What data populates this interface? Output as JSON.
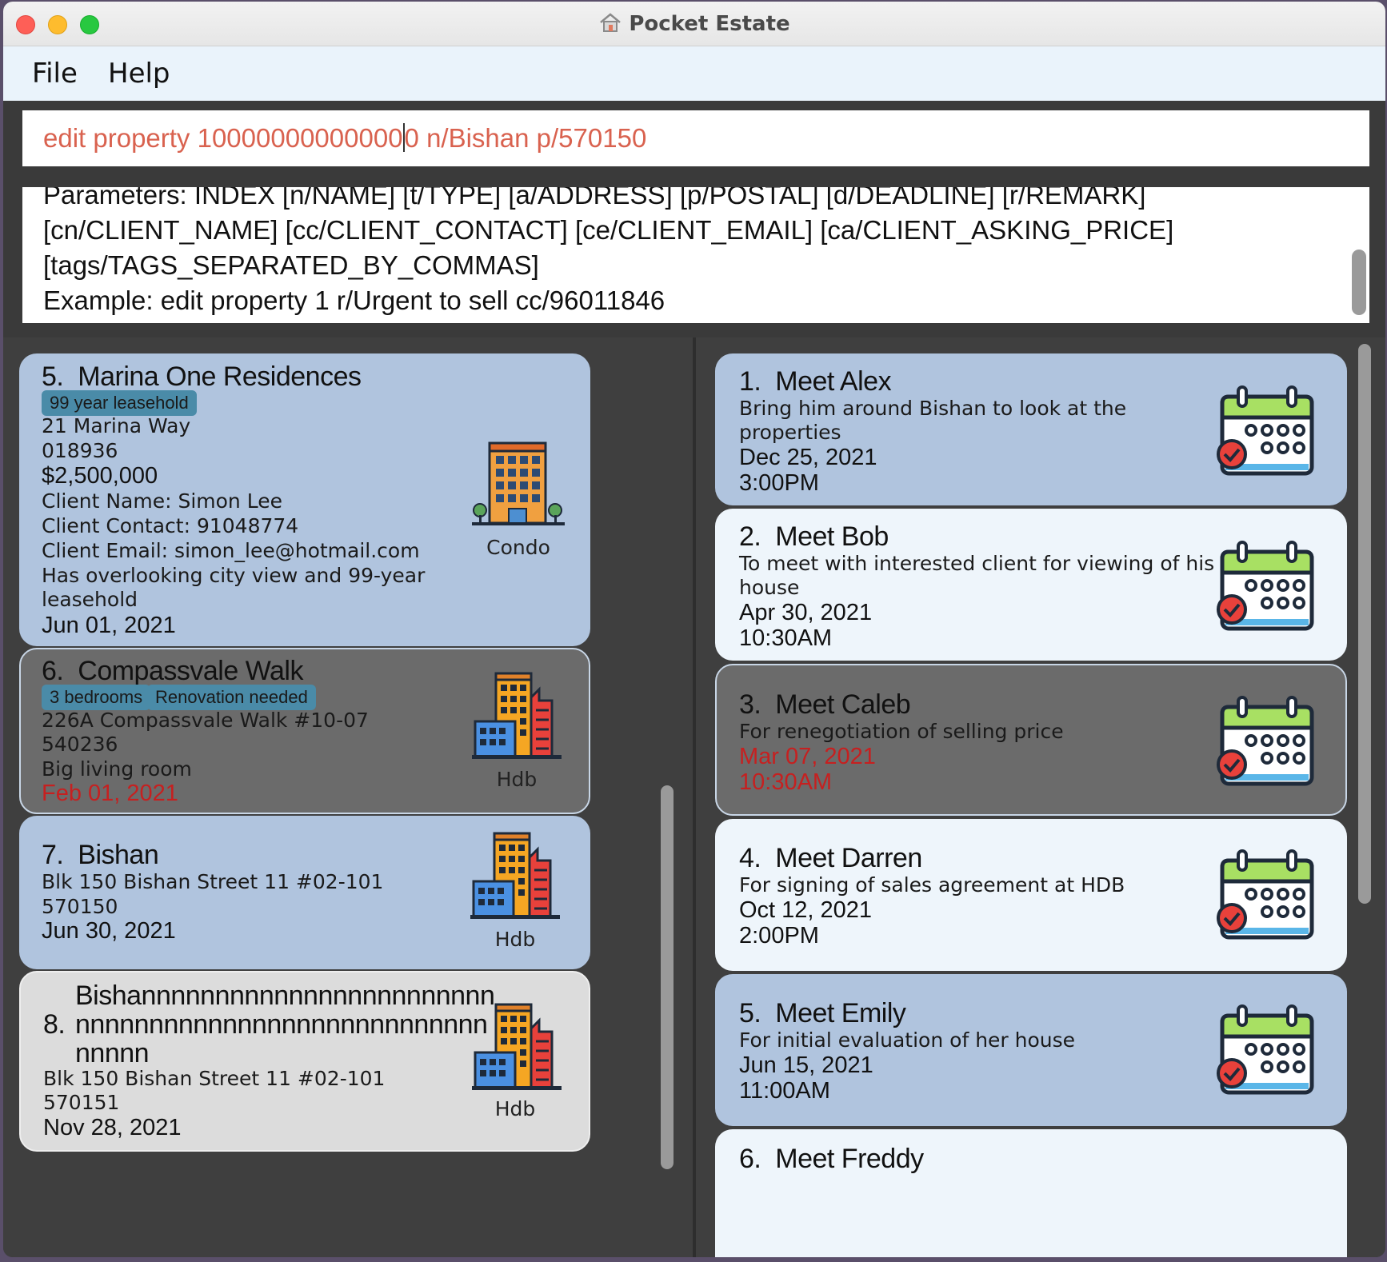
{
  "window": {
    "title": "Pocket Estate"
  },
  "menu": {
    "file": "File",
    "help": "Help"
  },
  "command": {
    "before_caret": "edit property 10000000000000",
    "after_caret": "0 n/Bishan p/570150"
  },
  "result": {
    "lines": [
      "Parameters: INDEX [n/NAME] [t/TYPE] [a/ADDRESS] [p/POSTAL] [d/DEADLINE] [r/REMARK]",
      "[cn/CLIENT_NAME] [cc/CLIENT_CONTACT] [ce/CLIENT_EMAIL] [ca/CLIENT_ASKING_PRICE]",
      "[tags/TAGS_SEPARATED_BY_COMMAS]",
      "Example: edit property 1 r/Urgent to sell cc/96011846"
    ]
  },
  "properties": [
    {
      "index": "5.",
      "name": "Marina One Residences",
      "tags": [
        "99 year leasehold"
      ],
      "address": "21 Marina Way",
      "postal": "018936",
      "price": "$2,500,000",
      "client_name": "Client Name: Simon Lee",
      "client_contact": "Client Contact: 91048774",
      "client_email": "Client Email: simon_lee@hotmail.com",
      "remark_1": "Has overlooking city view and 99-year",
      "remark_2": "leasehold",
      "deadline": "Jun 01, 2021",
      "type": "Condo",
      "icon": "condo-building-icon"
    },
    {
      "index": "6.",
      "name": "Compassvale Walk",
      "tags": [
        "3 bedrooms",
        "Renovation needed"
      ],
      "address": "226A Compassvale Walk #10-07",
      "postal": "540236",
      "remark_1": "Big living room",
      "deadline": "Feb 01, 2021",
      "type": "Hdb",
      "icon": "hdb-building-icon"
    },
    {
      "index": "7.",
      "name": "Bishan",
      "address": "Blk 150 Bishan Street 11 #02-101",
      "postal": "570150",
      "deadline": "Jun 30, 2021",
      "type": "Hdb",
      "icon": "hdb-building-icon"
    },
    {
      "index": "8.",
      "name_1": "Bishannnnnnnnnnnnnnnnnnnnnnnn",
      "name_2": "nnnnnnnnnnnnnnnnnnnnnnnnnnnn",
      "name_3": "nnnnn",
      "address": "Blk 150 Bishan Street 11 #02-101",
      "postal": "570151",
      "deadline": "Nov 28, 2021",
      "type": "Hdb",
      "icon": "hdb-building-icon"
    }
  ],
  "appointments": [
    {
      "index": "1.",
      "name": "Meet Alex",
      "remark_1": "Bring him around Bishan to look at the",
      "remark_2": "properties",
      "date": "Dec 25, 2021",
      "time": "3:00PM",
      "icon": "calendar-icon"
    },
    {
      "index": "2.",
      "name": "Meet Bob",
      "remark_1": "To meet with interested client for viewing of his",
      "remark_2": "house",
      "date": "Apr 30, 2021",
      "time": "10:30AM",
      "icon": "calendar-icon"
    },
    {
      "index": "3.",
      "name": "Meet Caleb",
      "remark_1": "For renegotiation of selling price",
      "date": "Mar 07, 2021",
      "time": "10:30AM",
      "icon": "calendar-icon"
    },
    {
      "index": "4.",
      "name": "Meet Darren",
      "remark_1": "For signing of sales agreement at HDB",
      "date": "Oct 12, 2021",
      "time": "2:00PM",
      "icon": "calendar-icon"
    },
    {
      "index": "5.",
      "name": "Meet Emily",
      "remark_1": "For initial evaluation of her house",
      "date": "Jun 15, 2021",
      "time": "11:00AM",
      "icon": "calendar-icon"
    },
    {
      "index": "6.",
      "name": "Meet Freddy"
    }
  ],
  "colors": {
    "card_blue": "#b0c4de",
    "card_white": "#eef5fb",
    "card_selected": "#6b6b6b",
    "tag": "#4a8ba8",
    "overdue": "#c62020",
    "command_text": "#d9624f"
  }
}
